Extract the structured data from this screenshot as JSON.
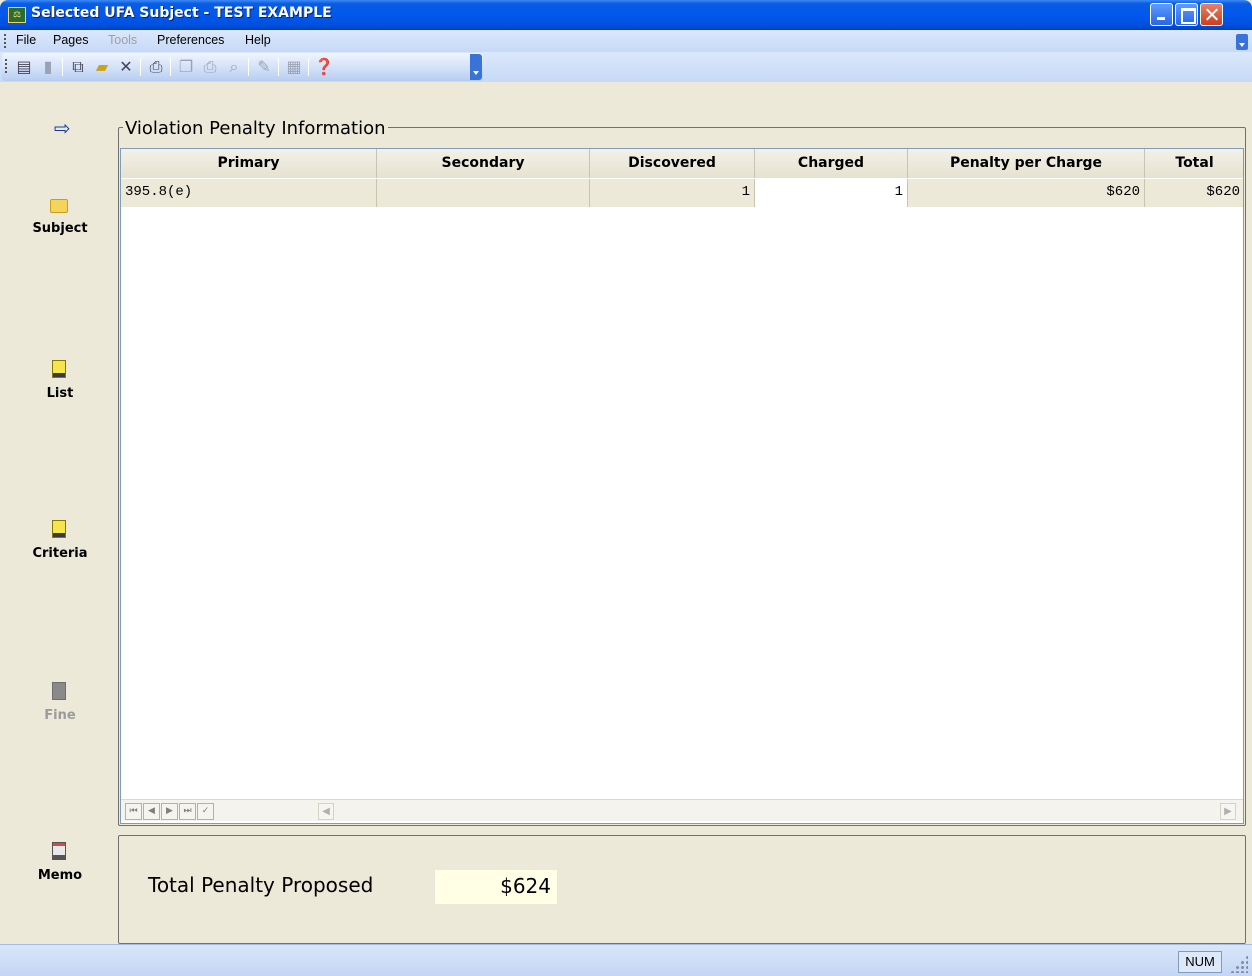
{
  "window": {
    "title": "Selected UFA Subject - TEST EXAMPLE",
    "title_icon": "app-scale-icon"
  },
  "menu": {
    "items": [
      {
        "label": "File",
        "enabled": true
      },
      {
        "label": "Pages",
        "enabled": true
      },
      {
        "label": "Tools",
        "enabled": false
      },
      {
        "label": "Preferences",
        "enabled": true
      },
      {
        "label": "Help",
        "enabled": true
      }
    ]
  },
  "toolbar": {
    "icons": [
      "new-icon",
      "save-icon",
      "open-icon",
      "folder-open-icon",
      "delete-icon",
      "print-icon",
      "copy-icon",
      "print-preview-icon",
      "search-icon",
      "edit-icon",
      "calculator-icon",
      "help-icon"
    ]
  },
  "sidebar": {
    "items": [
      {
        "label": "Subject",
        "icon": "folder-icon",
        "enabled": true
      },
      {
        "label": "List",
        "icon": "note-icon",
        "enabled": true
      },
      {
        "label": "Criteria",
        "icon": "note-icon",
        "enabled": true
      },
      {
        "label": "Fine",
        "icon": "fine-icon",
        "enabled": false
      },
      {
        "label": "Memo",
        "icon": "memo-icon",
        "enabled": true
      }
    ]
  },
  "main": {
    "group_title": "Violation Penalty Information",
    "columns": [
      "Primary",
      "Secondary",
      "Discovered",
      "Charged",
      "Penalty per Charge",
      "Total"
    ],
    "rows": [
      {
        "primary": "395.8(e)",
        "secondary": "",
        "discovered": "1",
        "charged": "1",
        "penalty_per_charge": "$620",
        "total": "$620"
      }
    ]
  },
  "summary": {
    "label": "Total Penalty Proposed",
    "value": "$624"
  },
  "status": {
    "num": "NUM"
  }
}
